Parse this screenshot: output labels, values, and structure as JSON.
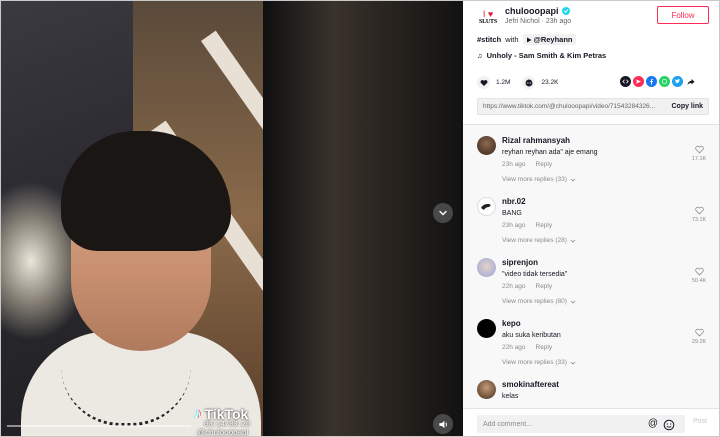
{
  "video": {
    "logo_text": "TikTok",
    "time": "00:14/00:20",
    "handle": "@chulooopapi",
    "progress": 0.0
  },
  "author": {
    "name": "chulooopapi",
    "sub": "Jefri Nichol · 23h ago",
    "avatar_heart": "I ♥",
    "avatar_text": "SLUTS",
    "follow_label": "Follow"
  },
  "description": {
    "hashtag": "#stitch",
    "with": "with",
    "stitch_user": "@Reyhann"
  },
  "music": {
    "title": "Unholy - Sam Smith & Kim Petras"
  },
  "stats": {
    "likes": "1.2M",
    "comments": "23.2K"
  },
  "link": {
    "url": "https://www.tiktok.com/@chulooopapi/video/71543284326...",
    "copy_label": "Copy link"
  },
  "comments": [
    {
      "name": "Rizal rahmansyah",
      "text": "reyhan reyhan ada\" aje emang",
      "time": "23h ago",
      "reply": "Reply",
      "more": "View more replies (33)",
      "likes": "17.1K"
    },
    {
      "name": "nbr.02",
      "text": "BANG",
      "time": "23h ago",
      "reply": "Reply",
      "more": "View more replies (28)",
      "likes": "73.1K"
    },
    {
      "name": "siprenjon",
      "text": "\"video tidak tersedia\"",
      "time": "22h ago",
      "reply": "Reply",
      "more": "View more replies (80)",
      "likes": "50.4K"
    },
    {
      "name": "kepo",
      "text": "aku suka keributan",
      "time": "22h ago",
      "reply": "Reply",
      "more": "View more replies (33)",
      "likes": "29.2K"
    },
    {
      "name": "smokinaftereat",
      "text": "kelas",
      "time": "",
      "reply": "",
      "more": "",
      "likes": ""
    }
  ],
  "composer": {
    "placeholder": "Add comment...",
    "post_label": "Post"
  },
  "colors": {
    "accent": "#fe2c55",
    "verified": "#20d5ec",
    "muted": "#8a8b91"
  }
}
